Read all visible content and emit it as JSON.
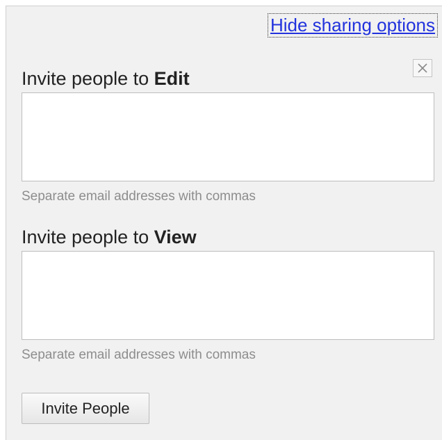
{
  "hide_link": "Hide sharing options",
  "close_icon": "close-icon",
  "edit_section": {
    "label_prefix": "Invite people to ",
    "label_bold": "Edit",
    "value": "",
    "hint": "Separate email addresses with commas"
  },
  "view_section": {
    "label_prefix": "Invite people to ",
    "label_bold": "View",
    "value": "",
    "hint": "Separate email addresses with commas"
  },
  "invite_button": "Invite People",
  "colors": {
    "link": "#2233dd",
    "panel_bg": "#f1f1f1",
    "hint_text": "#8d8d8d"
  }
}
